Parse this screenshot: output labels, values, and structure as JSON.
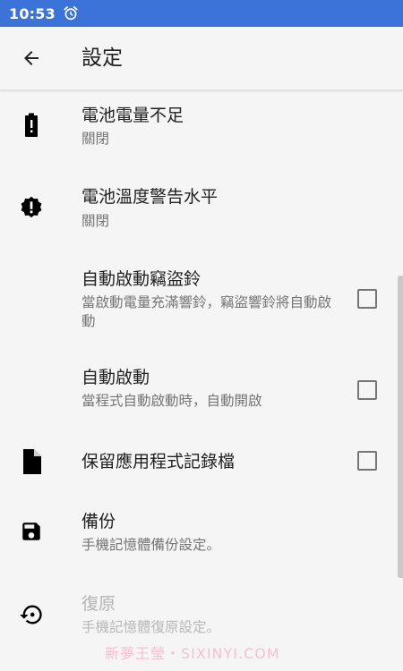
{
  "status_bar": {
    "time": "10:53",
    "alarm_icon": "alarm-clock-icon",
    "background_color": "#3b73d9"
  },
  "toolbar": {
    "back_icon": "arrow-back-icon",
    "title": "設定"
  },
  "settings": [
    {
      "icon": "battery-alert-icon",
      "title": "電池電量不足",
      "summary": "關閉",
      "checkbox": null,
      "enabled": true
    },
    {
      "icon": "alert-octagon-icon",
      "title": "電池溫度警告水平",
      "summary": "關閉",
      "checkbox": null,
      "enabled": true
    },
    {
      "icon": null,
      "title": "自動啟動竊盜鈴",
      "summary": "當啟動電量充滿響鈴，竊盜響鈴將自動啟動",
      "checkbox": false,
      "enabled": true
    },
    {
      "icon": null,
      "title": "自動啟動",
      "summary": "當程式自動啟動時，自動開啟",
      "checkbox": false,
      "enabled": true
    },
    {
      "icon": "file-icon",
      "title": "保留應用程式記錄檔",
      "summary": "",
      "checkbox": false,
      "enabled": true
    },
    {
      "icon": "save-floppy-icon",
      "title": "備份",
      "summary": "手機記憶體備份設定。",
      "checkbox": null,
      "enabled": true
    },
    {
      "icon": "restore-icon",
      "title": "復原",
      "summary": "手機記憶體復原設定。",
      "checkbox": null,
      "enabled": false
    }
  ],
  "watermark": "新夢王瑩・SIXINYI.COM"
}
